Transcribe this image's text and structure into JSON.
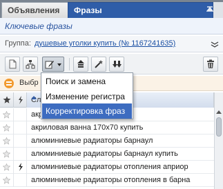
{
  "tabs": [
    {
      "label": "Объявления",
      "active": false
    },
    {
      "label": "Фразы",
      "active": true
    }
  ],
  "panel": {
    "title": "Ключевые фразы"
  },
  "group": {
    "label": "Группа:",
    "value": "душевые уголки купить (№ 1167241635)"
  },
  "toolbar": {
    "buttons": [
      "new-document-icon",
      "import-tree-icon",
      "edit-pencil-icon",
      "move-up-icon",
      "magic-wand-icon",
      "move-down-icon",
      "trash-icon"
    ]
  },
  "info_bar": {
    "text": "Выбр"
  },
  "table": {
    "columns": {
      "star": "",
      "flash": "",
      "phrase": "Сл"
    },
    "rows": [
      {
        "text": "акр",
        "starred": false,
        "flash": false
      },
      {
        "text": "акриловая ванна 170х70 купить",
        "starred": false,
        "flash": false
      },
      {
        "text": "алюминиевые радиаторы барнаул",
        "starred": false,
        "flash": false
      },
      {
        "text": "алюминиевые радиаторы барнаул купить",
        "starred": false,
        "flash": false
      },
      {
        "text": "алюминиевые радиаторы отопления априор",
        "starred": false,
        "flash": true
      },
      {
        "text": "алюминиевые радиаторы отопления в барна",
        "starred": false,
        "flash": false
      }
    ]
  },
  "menu": {
    "items": [
      {
        "label": "Поиск и замена",
        "highlighted": false
      },
      {
        "label": "Изменение регистра",
        "highlighted": false
      },
      {
        "label": "Корректировка фраз",
        "highlighted": true
      }
    ]
  },
  "colors": {
    "accent": "#2f5da8",
    "menu_highlight": "#3d6cc0",
    "info_icon": "#f29a2e"
  }
}
